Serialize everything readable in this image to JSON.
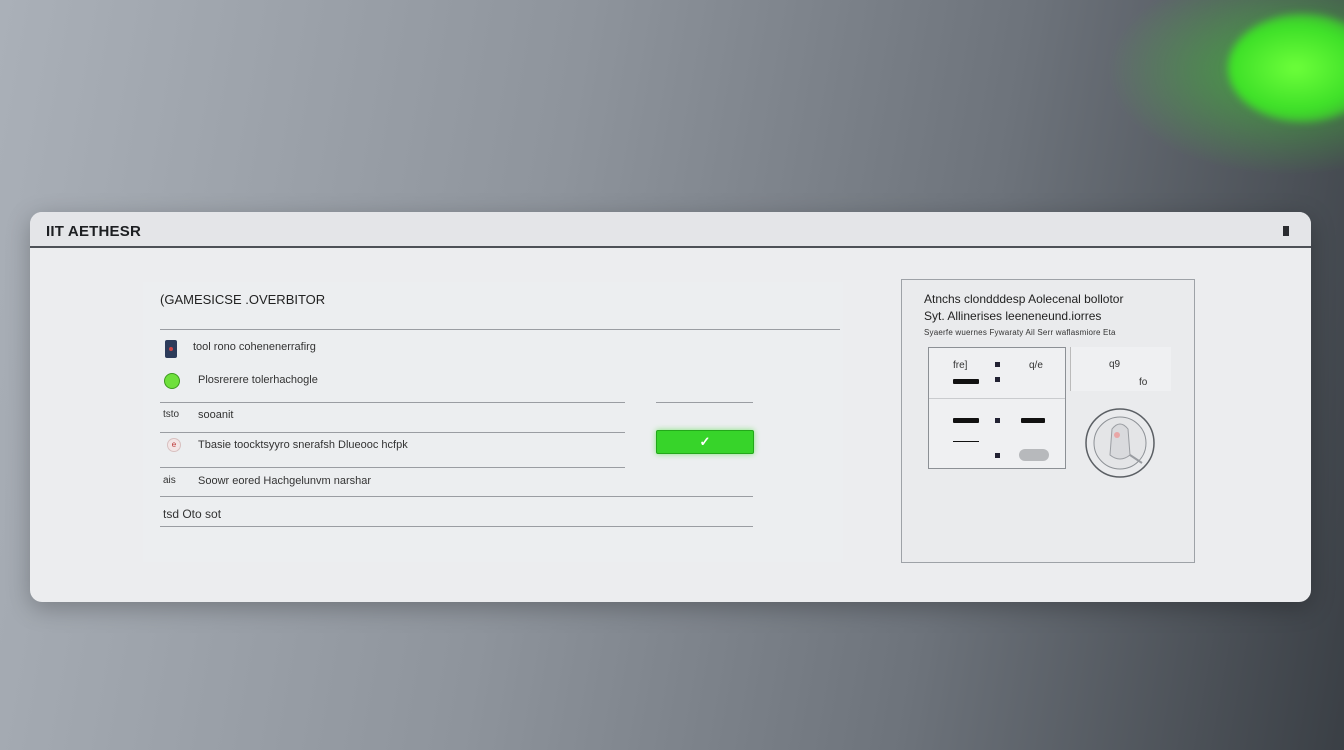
{
  "app": {
    "title": "IIT AETHESR"
  },
  "panel": {
    "title": "(GAMESICSE .OVERBITOR",
    "rows": [
      {
        "text": "tool rono cohenenerrafirg"
      },
      {
        "text": "Plosrerere tolerhachogle"
      },
      {
        "label": "tsto",
        "text": "sooanit"
      },
      {
        "text": "Tbasie toocktsyyro snerafsh Dlueooc hcfpk"
      },
      {
        "label": "ais",
        "text": "Soowr eored Hachgelunvm narshar"
      },
      {
        "text": "tsd Oto sot"
      }
    ],
    "confirm_glyph": "✓"
  },
  "side": {
    "heading": "Atnchs clondddesp Aolecenal bollotor",
    "subheading": "Syt. Allinerises leeneneund.iorres",
    "small_text": "Syaerfe wuernes Fywaraty Ail Serr waflasmiore Eta",
    "table": {
      "header_left": "fre]",
      "header_right": "q/e"
    },
    "right_values": {
      "top": "q9",
      "bottom": "fo"
    }
  },
  "colors": {
    "accent": "#37d42a",
    "glow": "#4fe830"
  }
}
